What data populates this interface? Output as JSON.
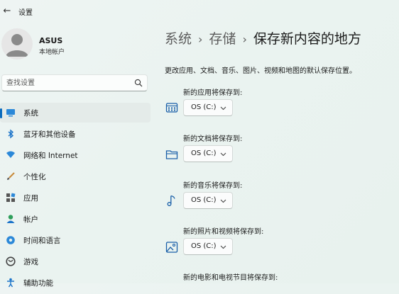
{
  "window": {
    "title": "设置"
  },
  "user": {
    "name": "ASUS",
    "account_type": "本地帐户"
  },
  "search": {
    "placeholder": "查找设置"
  },
  "sidebar": {
    "items": [
      {
        "label": "系统",
        "icon": "system-icon",
        "active": true
      },
      {
        "label": "蓝牙和其他设备",
        "icon": "bluetooth-icon"
      },
      {
        "label": "网络和 Internet",
        "icon": "wifi-icon"
      },
      {
        "label": "个性化",
        "icon": "brush-icon"
      },
      {
        "label": "应用",
        "icon": "apps-icon"
      },
      {
        "label": "帐户",
        "icon": "account-icon"
      },
      {
        "label": "时间和语言",
        "icon": "globe-clock-icon"
      },
      {
        "label": "游戏",
        "icon": "game-icon"
      },
      {
        "label": "辅助功能",
        "icon": "accessibility-icon"
      }
    ]
  },
  "breadcrumb": {
    "level1": "系统",
    "level2": "存储",
    "current": "保存新内容的地方"
  },
  "description": "更改应用、文档、音乐、图片、视频和地图的默认保存位置。",
  "settings": [
    {
      "label": "新的应用将保存到:",
      "value": "OS (C:)",
      "icon": "apps-grid-icon"
    },
    {
      "label": "新的文档将保存到:",
      "value": "OS (C:)",
      "icon": "folder-icon"
    },
    {
      "label": "新的音乐将保存到:",
      "value": "OS (C:)",
      "icon": "music-note-icon"
    },
    {
      "label": "新的照片和视频将保存到:",
      "value": "OS (C:)",
      "icon": "photo-icon"
    },
    {
      "label": "新的电影和电视节目将保存到:",
      "value": "",
      "icon": ""
    }
  ],
  "colors": {
    "accent": "#0b6cbd",
    "background": "#eaf3f0"
  }
}
